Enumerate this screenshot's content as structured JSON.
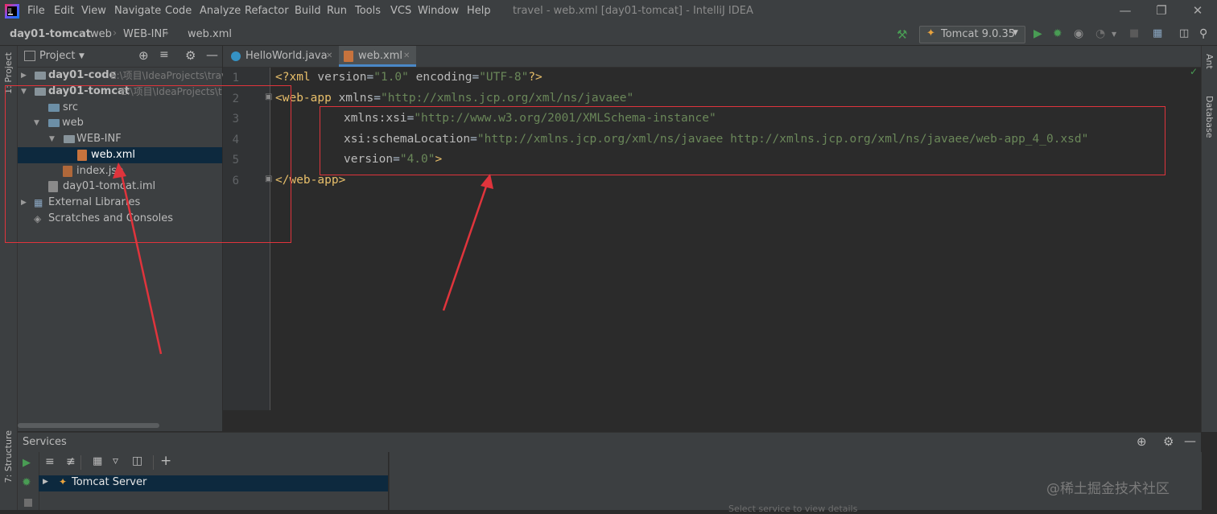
{
  "menubar": {
    "items": [
      "File",
      "Edit",
      "View",
      "Navigate",
      "Code",
      "Analyze",
      "Refactor",
      "Build",
      "Run",
      "Tools",
      "VCS",
      "Window",
      "Help"
    ],
    "title": "travel - web.xml [day01-tomcat] - IntelliJ IDEA"
  },
  "navbar": {
    "breadcrumbs": [
      "day01-tomcat",
      "web",
      "WEB-INF",
      "web.xml"
    ],
    "run_config": "Tomcat 9.0.35"
  },
  "left_strip": {
    "project_label": "1: Project",
    "structure_label": "7: Structure"
  },
  "right_strip": {
    "ant_label": "Ant",
    "database_label": "Database"
  },
  "project_panel": {
    "title": "Project",
    "tree": [
      {
        "label": "day01-code",
        "path": "E:\\项目\\IdeaProjects\\trav"
      },
      {
        "label": "day01-tomcat",
        "path": "E:\\项目\\IdeaProjects\\tr"
      },
      {
        "label": "src"
      },
      {
        "label": "web"
      },
      {
        "label": "WEB-INF"
      },
      {
        "label": "web.xml"
      },
      {
        "label": "index.jsp"
      },
      {
        "label": "day01-tomcat.iml"
      },
      {
        "label": "External Libraries"
      },
      {
        "label": "Scratches and Consoles"
      }
    ]
  },
  "editor": {
    "tabs": [
      {
        "label": "HelloWorld.java"
      },
      {
        "label": "web.xml"
      }
    ],
    "line_numbers": [
      "1",
      "2",
      "3",
      "4",
      "5",
      "6"
    ],
    "code": {
      "l1_open": "<?xml ",
      "l1_attr1": "version",
      "l1_val1": "\"1.0\"",
      "l1_attr2": " encoding",
      "l1_val2": "\"UTF-8\"",
      "l1_close": "?>",
      "l2_tag": "<web-app ",
      "l2_attr": "xmlns",
      "l2_val": "\"http://xmlns.jcp.org/xml/ns/javaee\"",
      "l3_attr": "xmlns:xsi",
      "l3_val": "\"http://www.w3.org/2001/XMLSchema-instance\"",
      "l4_attr": "xsi:schemaLocation",
      "l4_val": "\"http://xmlns.jcp.org/xml/ns/javaee http://xmlns.jcp.org/xml/ns/javaee/web-app_4_0.xsd\"",
      "l5_attr": "version",
      "l5_val": "\"4.0\"",
      "l5_close": ">",
      "l6_tag": "</web-app>"
    }
  },
  "services": {
    "title": "Services",
    "tree_item": "Tomcat Server",
    "empty_hint": "Select service to view details"
  },
  "watermark": "@稀土掘金技术社区",
  "colors": {
    "annotation": "#e0343c",
    "selection": "#0d293e",
    "xml_tag": "#e8bf6a",
    "xml_value": "#6a8759"
  }
}
